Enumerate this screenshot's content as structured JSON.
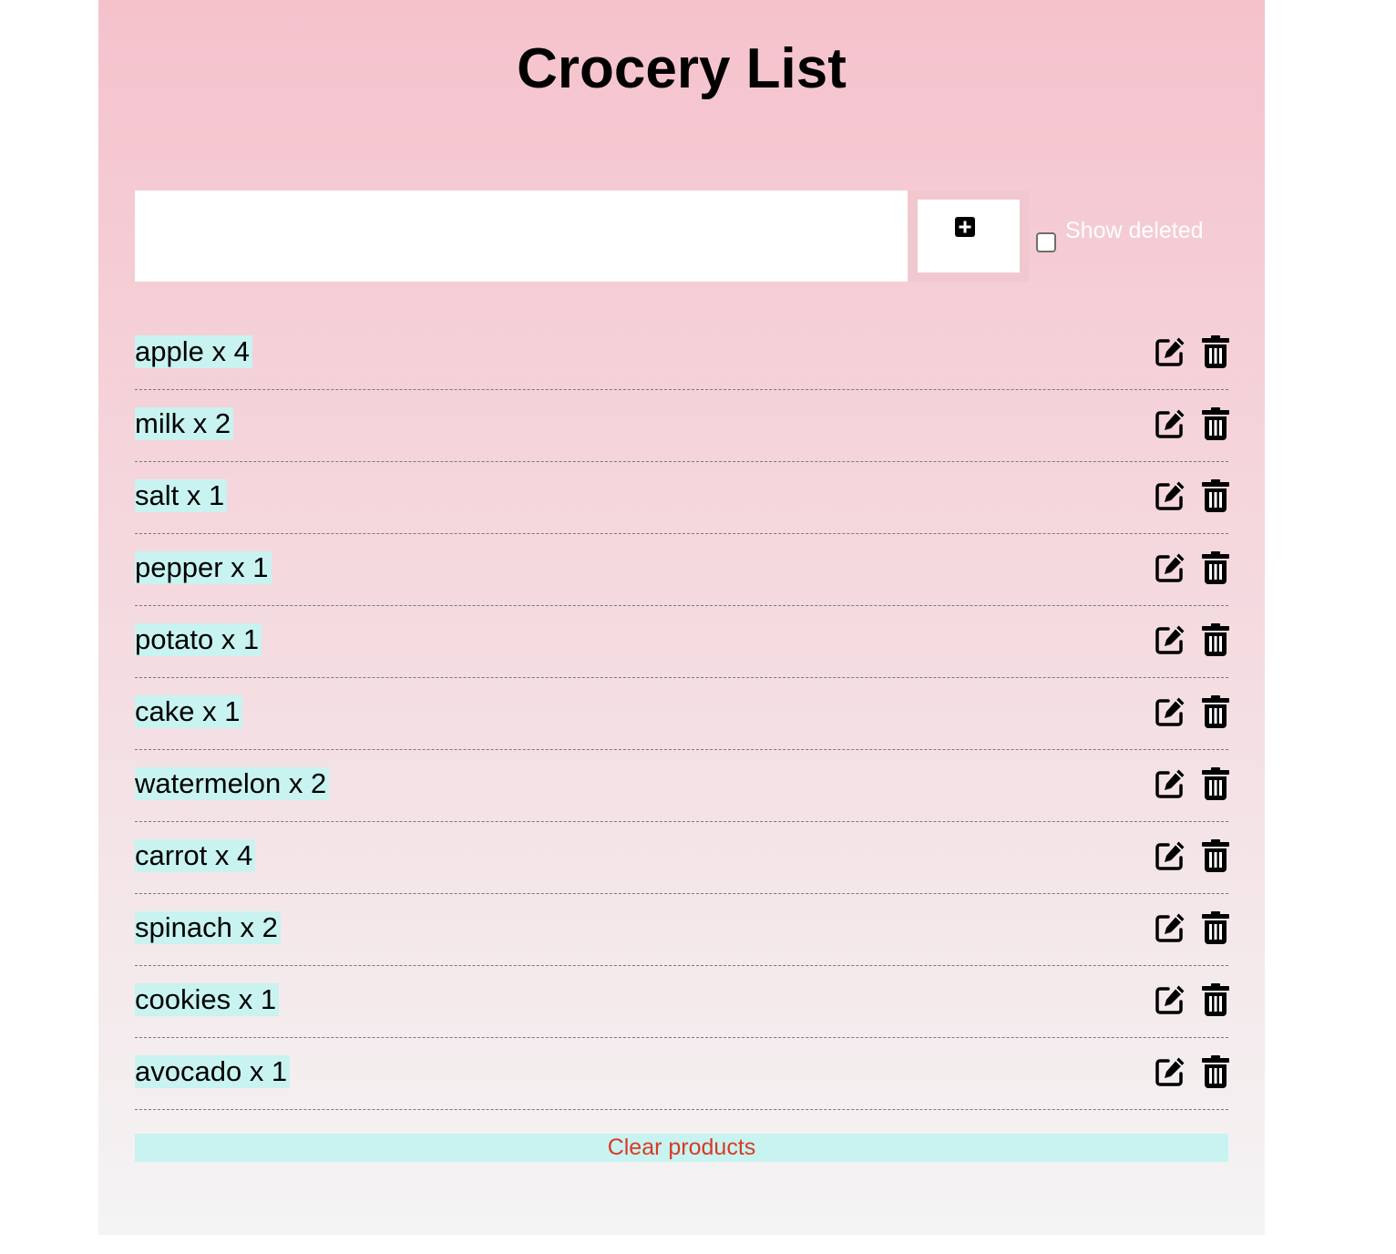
{
  "header": {
    "title": "Crocery List"
  },
  "add_form": {
    "input_value": "",
    "add_button_icon": "plus-square-icon",
    "show_deleted_label": "Show deleted",
    "show_deleted_checked": false
  },
  "items": [
    {
      "label": "apple x 4"
    },
    {
      "label": "milk x 2"
    },
    {
      "label": "salt x 1"
    },
    {
      "label": "pepper x 1"
    },
    {
      "label": "potato x 1"
    },
    {
      "label": "cake x 1"
    },
    {
      "label": "watermelon x 2"
    },
    {
      "label": "carrot x 4"
    },
    {
      "label": "spinach x 2"
    },
    {
      "label": "cookies x 1"
    },
    {
      "label": "avocado x 1"
    }
  ],
  "item_actions": {
    "edit_icon": "edit-icon",
    "delete_icon": "trash-icon"
  },
  "footer": {
    "clear_label": "Clear products"
  },
  "colors": {
    "background_top": "#f5c2cc",
    "background_bottom": "#f4f4f4",
    "item_highlight": "#c8f3f1",
    "clear_text": "#d93a24"
  }
}
